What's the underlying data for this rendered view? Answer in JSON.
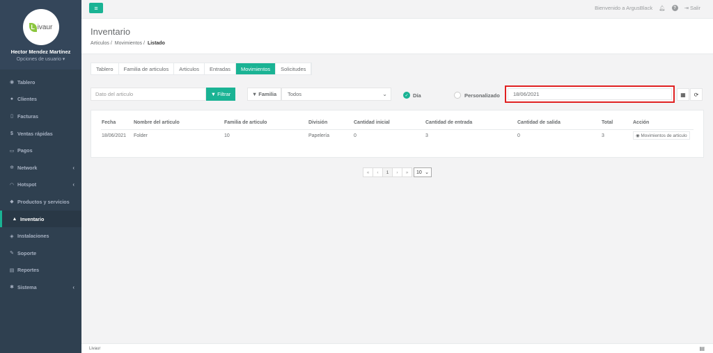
{
  "sidebar": {
    "logo_letter": "L",
    "logo_text": "ivaur",
    "user_name": "Hector Mendez Martínez",
    "user_options": "Opciones de usuario ▾",
    "items": [
      {
        "label": "Tablero",
        "icon": "dashboard-icon"
      },
      {
        "label": "Clientes",
        "icon": "users-icon"
      },
      {
        "label": "Facturas",
        "icon": "file-icon"
      },
      {
        "label": "Ventas rápidas",
        "icon": "dollar-icon"
      },
      {
        "label": "Pagos",
        "icon": "money-icon"
      },
      {
        "label": "Network",
        "icon": "network-icon"
      },
      {
        "label": "Hotspot",
        "icon": "wifi-icon"
      },
      {
        "label": "Productos y servicios",
        "icon": "tag-icon"
      },
      {
        "label": "Inventario",
        "icon": "cubes-icon"
      },
      {
        "label": "Instalaciones",
        "icon": "pin-icon"
      },
      {
        "label": "Soporte",
        "icon": "wrench-icon"
      },
      {
        "label": "Reportes",
        "icon": "book-icon"
      },
      {
        "label": "Sistema",
        "icon": "cogs-icon"
      }
    ]
  },
  "topbar": {
    "welcome": "Bienvenido a ArgusBlack",
    "logout": "Salir"
  },
  "header": {
    "title": "Inventario",
    "breadcrumb": [
      "Articulos",
      "Movimientos",
      "Listado"
    ]
  },
  "tabs": [
    "Tablero",
    "Familia de articulos",
    "Articulos",
    "Entradas",
    "Movimientos",
    "Solicitudes"
  ],
  "filters": {
    "article_placeholder": "Dato del articulo",
    "filter_button": "Filtrar",
    "family_label": "Familia",
    "family_value": "Todos",
    "radio_day": "Día",
    "radio_custom": "Personalizado",
    "date_value": "18/06/2021"
  },
  "table": {
    "headers": [
      "Fecha",
      "Nombre del articulo",
      "Familia de articulo",
      "División",
      "Cantidad inicial",
      "Cantidad de entrada",
      "Cantidad de salida",
      "Total",
      "Acción"
    ],
    "rows": [
      [
        "18/06/2021",
        "Folder",
        "10",
        "Papelería",
        "0",
        "3",
        "0",
        "3",
        "Movimientos de articulo"
      ]
    ]
  },
  "pagination": {
    "first": "«",
    "prev": "‹",
    "page": "1",
    "next": "›",
    "last": "»",
    "page_size": "10"
  },
  "footer": {
    "text": "Livaur"
  },
  "colors": {
    "accent": "#1ab394",
    "sidebar": "#2f4050",
    "highlight": "#e02020"
  }
}
